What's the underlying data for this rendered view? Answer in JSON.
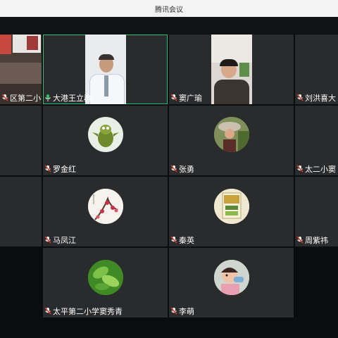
{
  "window": {
    "title": "腾讯会议"
  },
  "colors": {
    "active_border": "#27c27a",
    "tile_bg": "#2a2b2d",
    "muted_mic": "#d33c2e",
    "active_mic": "#2fbf5a"
  },
  "participants": [
    {
      "name": "区第二小学)",
      "mic": "muted",
      "content": "video"
    },
    {
      "name": "大港王立群",
      "mic": "active",
      "content": "video"
    },
    {
      "name": "窦广瑜",
      "mic": "muted",
      "content": "video"
    },
    {
      "name": "刘洪喜大",
      "mic": "muted",
      "content": "blank"
    },
    {
      "name": "",
      "mic": "none",
      "content": "blank"
    },
    {
      "name": "罗金红",
      "mic": "muted",
      "content": "avatar",
      "icon": "leaf-creature-avatar-icon"
    },
    {
      "name": "张勇",
      "mic": "muted",
      "content": "avatar",
      "icon": "person-hat-avatar-icon"
    },
    {
      "name": "太二小窦",
      "mic": "muted",
      "content": "blank"
    },
    {
      "name": "",
      "mic": "none",
      "content": "blank"
    },
    {
      "name": "马凤江",
      "mic": "muted",
      "content": "avatar",
      "icon": "plum-blossom-avatar-icon"
    },
    {
      "name": "秦英",
      "mic": "muted",
      "content": "avatar",
      "icon": "book-cover-avatar-icon"
    },
    {
      "name": "周紫祎",
      "mic": "muted",
      "content": "blank"
    },
    {
      "name": "太平第二小学窦秀青",
      "mic": "muted",
      "content": "avatar",
      "icon": "green-leaves-avatar-icon"
    },
    {
      "name": "李萌",
      "mic": "muted",
      "content": "avatar",
      "icon": "child-drinking-avatar-icon"
    }
  ]
}
